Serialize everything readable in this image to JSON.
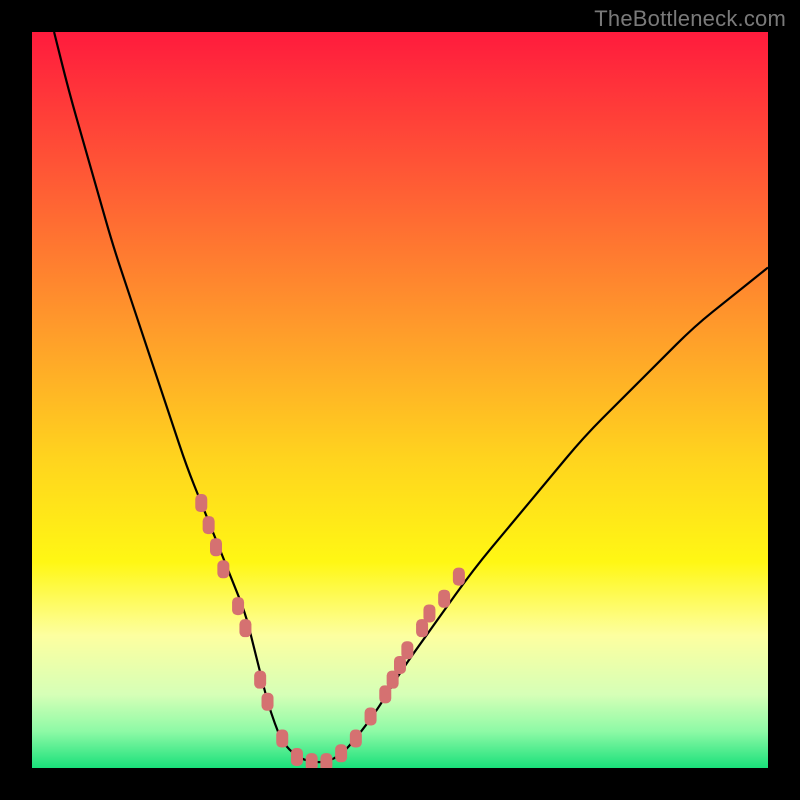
{
  "watermark": "TheBottleneck.com",
  "chart_data": {
    "type": "line",
    "title": "",
    "xlabel": "",
    "ylabel": "",
    "xlim": [
      0,
      100
    ],
    "ylim": [
      0,
      100
    ],
    "grid": false,
    "background_gradient": {
      "type": "vertical",
      "stops": [
        {
          "pos": 0.0,
          "color": "#ff1b3d"
        },
        {
          "pos": 0.2,
          "color": "#ff5a35"
        },
        {
          "pos": 0.4,
          "color": "#ff9a2b"
        },
        {
          "pos": 0.58,
          "color": "#ffd41e"
        },
        {
          "pos": 0.72,
          "color": "#fff714"
        },
        {
          "pos": 0.82,
          "color": "#fdffa0"
        },
        {
          "pos": 0.9,
          "color": "#d6ffb7"
        },
        {
          "pos": 0.95,
          "color": "#8efaa6"
        },
        {
          "pos": 1.0,
          "color": "#19e07a"
        }
      ]
    },
    "series": [
      {
        "name": "bottleneck-curve",
        "x": [
          3,
          5,
          7,
          9,
          11,
          13,
          15,
          17,
          19,
          21,
          23,
          25,
          27,
          29,
          30,
          31,
          32,
          33,
          34,
          36,
          38,
          40,
          42,
          44,
          47,
          50,
          55,
          60,
          65,
          70,
          75,
          80,
          85,
          90,
          95,
          100
        ],
        "values": [
          100,
          92,
          85,
          78,
          71,
          65,
          59,
          53,
          47,
          41,
          36,
          31,
          26,
          21,
          17,
          13,
          9,
          6,
          3.5,
          1.5,
          0.8,
          0.8,
          1.8,
          4,
          8,
          13,
          20,
          27,
          33,
          39,
          45,
          50,
          55,
          60,
          64,
          68
        ],
        "color": "#000000"
      }
    ],
    "markers": {
      "name": "highlight-dots",
      "color": "#d57171",
      "shape": "rounded-rect",
      "points": [
        {
          "x": 23,
          "y": 36
        },
        {
          "x": 24,
          "y": 33
        },
        {
          "x": 25,
          "y": 30
        },
        {
          "x": 26,
          "y": 27
        },
        {
          "x": 28,
          "y": 22
        },
        {
          "x": 29,
          "y": 19
        },
        {
          "x": 31,
          "y": 12
        },
        {
          "x": 32,
          "y": 9
        },
        {
          "x": 34,
          "y": 4
        },
        {
          "x": 36,
          "y": 1.5
        },
        {
          "x": 38,
          "y": 0.8
        },
        {
          "x": 40,
          "y": 0.8
        },
        {
          "x": 42,
          "y": 2
        },
        {
          "x": 44,
          "y": 4
        },
        {
          "x": 46,
          "y": 7
        },
        {
          "x": 48,
          "y": 10
        },
        {
          "x": 49,
          "y": 12
        },
        {
          "x": 50,
          "y": 14
        },
        {
          "x": 51,
          "y": 16
        },
        {
          "x": 53,
          "y": 19
        },
        {
          "x": 54,
          "y": 21
        },
        {
          "x": 56,
          "y": 23
        },
        {
          "x": 58,
          "y": 26
        }
      ]
    }
  }
}
